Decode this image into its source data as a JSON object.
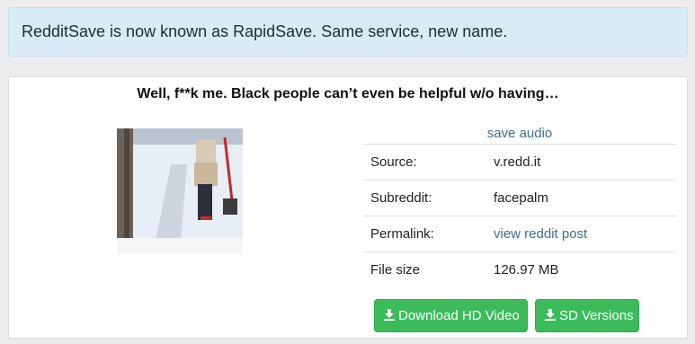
{
  "notice": {
    "text": "RedditSave is now known as RapidSave. Same service, new name."
  },
  "post": {
    "title": "Well, f**k me. Black people can’t even be helpful w/o having…"
  },
  "media": {
    "save_audio_label": "save audio"
  },
  "details": {
    "source_label": "Source:",
    "source_value": "v.redd.it",
    "subreddit_label": "Subreddit:",
    "subreddit_value": "facepalm",
    "permalink_label": "Permalink:",
    "permalink_value": "view reddit post",
    "filesize_label": "File size",
    "filesize_value": "126.97 MB"
  },
  "actions": {
    "download_hd_label": "Download HD Video",
    "sd_versions_label": "SD Versions"
  },
  "icons": {
    "download": "download-icon"
  },
  "colors": {
    "notice_bg": "#d9ecf5",
    "link": "#3c6f94",
    "button_green": "#3cbb5b"
  }
}
